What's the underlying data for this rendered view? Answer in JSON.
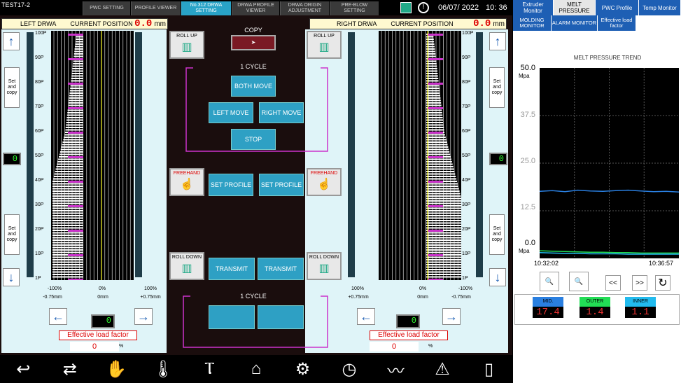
{
  "topbar": {
    "machine": "TEST17-2",
    "tabs": [
      "PWC SETTING",
      "PROFILE VIEWER",
      "No.312 DRWA SETTING",
      "DRWA PROFILE VIEWER",
      "DRWA ORIGIN ADJUSTMENT",
      "PRE-BLOW SETTING"
    ],
    "active_tab": 2,
    "date": "06/07/ 2022",
    "time": "10: 36"
  },
  "left": {
    "title": "LEFT DRWA",
    "pos_label": "CURRENT POSITION",
    "pos_value": "0.0",
    "pos_unit": "mm",
    "pticks": [
      "100P",
      "90P",
      "80P",
      "70P",
      "60P",
      "50P",
      "40P",
      "30P",
      "20P",
      "10P",
      "1P"
    ],
    "axis_top": [
      "-100%",
      "0%",
      "100%"
    ],
    "axis_bottom": [
      "-0.75mm",
      "0mm",
      "+0.75mm"
    ],
    "set_copy": "Set and copy",
    "zero": "0",
    "elf_label": "Effective load factor",
    "elf_value": "0",
    "elf_unit": "%"
  },
  "right": {
    "title": "RIGHT DRWA",
    "pos_label": "CURRENT POSITION",
    "pos_value": "0.0",
    "pos_unit": "mm",
    "axis_top": [
      "100%",
      "0%",
      "-100%"
    ],
    "axis_bottom": [
      "+0.75mm",
      "0mm",
      "-0.75mm"
    ],
    "zero": "0",
    "elf_label": "Effective load factor",
    "elf_value": "0",
    "elf_unit": "%"
  },
  "center": {
    "copy": "COPY",
    "cycle_top": "1 CYCLE",
    "both_move": "BOTH MOVE",
    "left_move": "LEFT MOVE",
    "right_move": "RIGHT MOVE",
    "stop": "STOP",
    "set_profile": "SET PROFILE",
    "transmit": "TRANSMIT",
    "cycle_bottom": "1 CYCLE",
    "roll_up": "ROLL UP",
    "freehand": "FREEHAND",
    "roll_down": "ROLL DOWN"
  },
  "rightpanel": {
    "tabs": [
      "Extruder Monitor",
      "MELT PRESSURE",
      "PWC Profile",
      "Temp Monitor"
    ],
    "active_tab": 1,
    "tabs2": [
      "MOLDING MONITOR",
      "ALARM MONITOR",
      "Effective load factor"
    ],
    "trend_title": "MELT PRESSURE TREND",
    "yticks": [
      "50.0",
      "37.5",
      "25.0",
      "12.5",
      "0.0"
    ],
    "yunit_top": "Mpa",
    "yunit_bottom": "Mpa",
    "time_start": "10:32:02",
    "time_end": "10:36:57",
    "gauges": [
      {
        "label": "MID.",
        "value": "17.4",
        "color": "#2a7fe0"
      },
      {
        "label": "OUTER",
        "value": "1.4",
        "color": "#22dd55"
      },
      {
        "label": "INNER",
        "value": "1.1",
        "color": "#22bbee"
      }
    ]
  },
  "chart_data": {
    "type": "line",
    "title": "MELT PRESSURE TREND",
    "ylabel": "Mpa",
    "ylim": [
      0,
      50
    ],
    "x": [
      "10:32:02",
      "10:36:57"
    ],
    "series": [
      {
        "name": "MID.",
        "values": [
          17.6,
          17.8,
          17.5,
          17.9,
          17.7,
          17.6,
          17.8,
          17.9,
          17.7,
          17.5,
          17.6,
          17.4
        ]
      },
      {
        "name": "OUTER",
        "values": [
          2.0,
          1.9,
          1.8,
          1.7,
          1.6,
          1.6,
          1.5,
          1.5,
          1.4,
          1.4,
          1.4,
          1.4
        ]
      },
      {
        "name": "INNER",
        "values": [
          1.5,
          1.4,
          1.3,
          1.3,
          1.2,
          1.2,
          1.2,
          1.1,
          1.1,
          1.1,
          1.1,
          1.1
        ]
      }
    ]
  }
}
